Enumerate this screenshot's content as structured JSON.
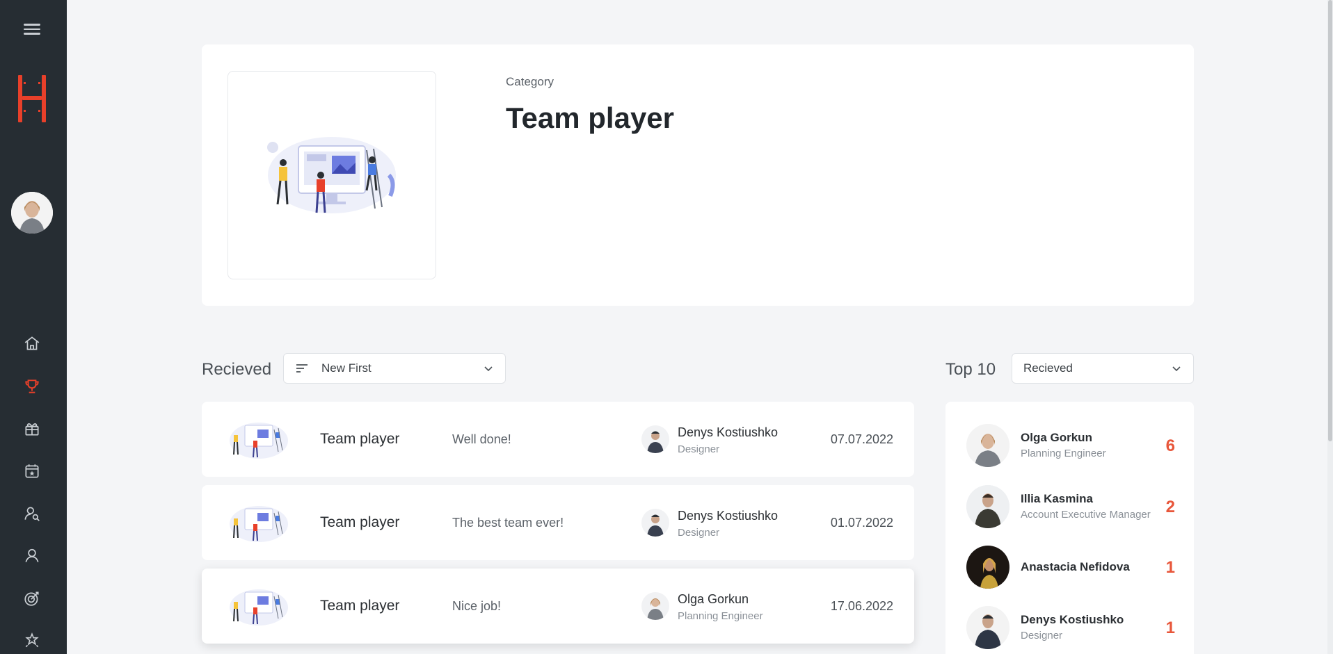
{
  "sidebar": {
    "icons": [
      "menu-icon",
      "logo",
      "home-icon",
      "trophy-icon",
      "gift-icon",
      "calendar-star-icon",
      "user-search-icon",
      "user-icon",
      "target-icon",
      "stars-icon"
    ],
    "accent_color": "#e8402a"
  },
  "header": {
    "category_label": "Category",
    "category_title": "Team player"
  },
  "received": {
    "title": "Recieved",
    "sort_label": "New First",
    "items": [
      {
        "title": "Team player",
        "message": "Well done!",
        "name": "Denys Kostiushko",
        "role": "Designer",
        "date": "07.07.2022"
      },
      {
        "title": "Team player",
        "message": "The best team ever!",
        "name": "Denys Kostiushko",
        "role": "Designer",
        "date": "01.07.2022"
      },
      {
        "title": "Team player",
        "message": "Nice job!",
        "name": "Olga Gorkun",
        "role": "Planning Engineer",
        "date": "17.06.2022"
      }
    ]
  },
  "top10": {
    "title": "Top 10",
    "filter_label": "Recieved",
    "rows": [
      {
        "name": "Olga Gorkun",
        "role": "Planning Engineer",
        "count": "6"
      },
      {
        "name": "Illia Kasmina",
        "role": "Account Executive Manager",
        "count": "2"
      },
      {
        "name": "Anastacia Nefidova",
        "role": "",
        "count": "1"
      },
      {
        "name": "Denys Kostiushko",
        "role": "Designer",
        "count": "1"
      }
    ],
    "count_color": "#e8563a"
  }
}
